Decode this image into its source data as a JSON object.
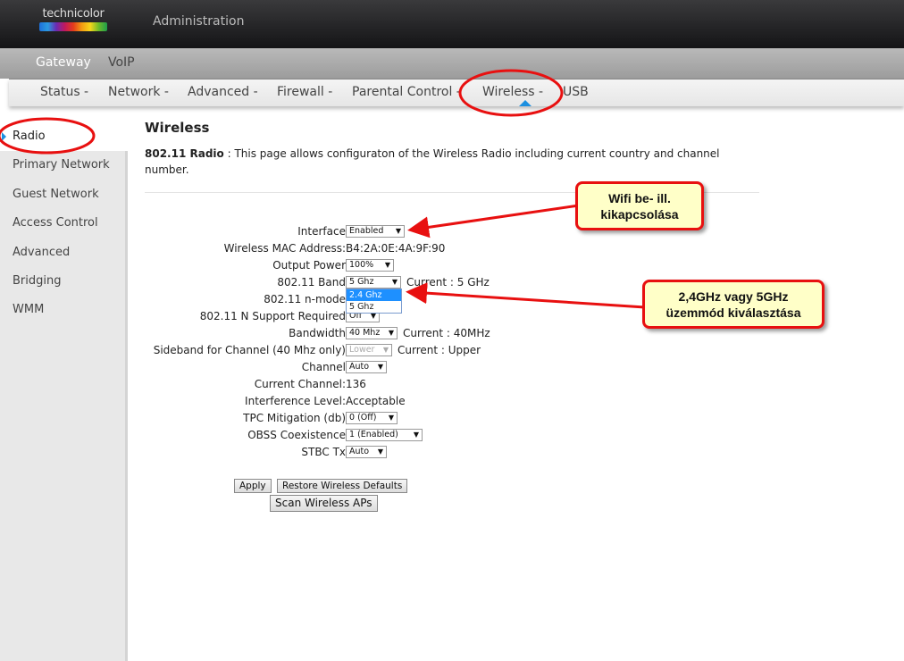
{
  "header": {
    "logo_text": "technicolor",
    "title": "Administration"
  },
  "topnav": [
    "Gateway",
    "VoIP"
  ],
  "subnav": [
    "Status -",
    "Network -",
    "Advanced -",
    "Firewall -",
    "Parental Control -",
    "Wireless -",
    "USB"
  ],
  "sidebar": [
    "Radio",
    "Primary Network",
    "Guest Network",
    "Access Control",
    "Advanced",
    "Bridging",
    "WMM"
  ],
  "page": {
    "title": "Wireless",
    "desc_bold": "802.11 Radio",
    "desc": "  :  This page allows configuraton of the Wireless Radio including current country and channel number."
  },
  "form": [
    {
      "label": "Interface",
      "select": "Enabled"
    },
    {
      "label": "Wireless MAC Address:",
      "value": "B4:2A:0E:4A:9F:90"
    },
    {
      "label": "Output Power",
      "select": "100%"
    },
    {
      "label": "802.11 Band",
      "select": "5 Ghz",
      "current": "Current :  5 GHz"
    },
    {
      "label": "802.11 n-mode",
      "select": ""
    },
    {
      "label": "802.11 N Support Required",
      "select": "Off"
    },
    {
      "label": "Bandwidth",
      "select": "40 Mhz",
      "current": "Current :  40MHz"
    },
    {
      "label": "Sideband for Channel (40 Mhz only)",
      "select": "Lower",
      "current": "Current : Upper",
      "disabled": true
    },
    {
      "label": "Channel",
      "select": "Auto"
    },
    {
      "label": "Current Channel:",
      "value": "136"
    },
    {
      "label": "Interference Level:",
      "value": "Acceptable"
    },
    {
      "label": "TPC Mitigation (db)",
      "select": "0 (Off)"
    },
    {
      "label": "OBSS Coexistence",
      "select": "1 (Enabled)"
    },
    {
      "label": "STBC Tx",
      "select": "Auto"
    }
  ],
  "band_dropdown": {
    "options": [
      "2.4 Ghz",
      "5 Ghz"
    ],
    "highlighted": "2.4 Ghz"
  },
  "buttons": {
    "apply": "Apply",
    "restore": "Restore Wireless Defaults",
    "scan": "Scan Wireless APs"
  },
  "callouts": {
    "wifi": [
      "Wifi be- ill.",
      "kikapcsolása"
    ],
    "band": [
      "2,4GHz vagy 5GHz",
      "üzemmód kiválasztása"
    ]
  },
  "colors": {
    "accent": "#1b8fe0",
    "annotation": "#e81010",
    "callout_bg": "#ffffc8"
  }
}
